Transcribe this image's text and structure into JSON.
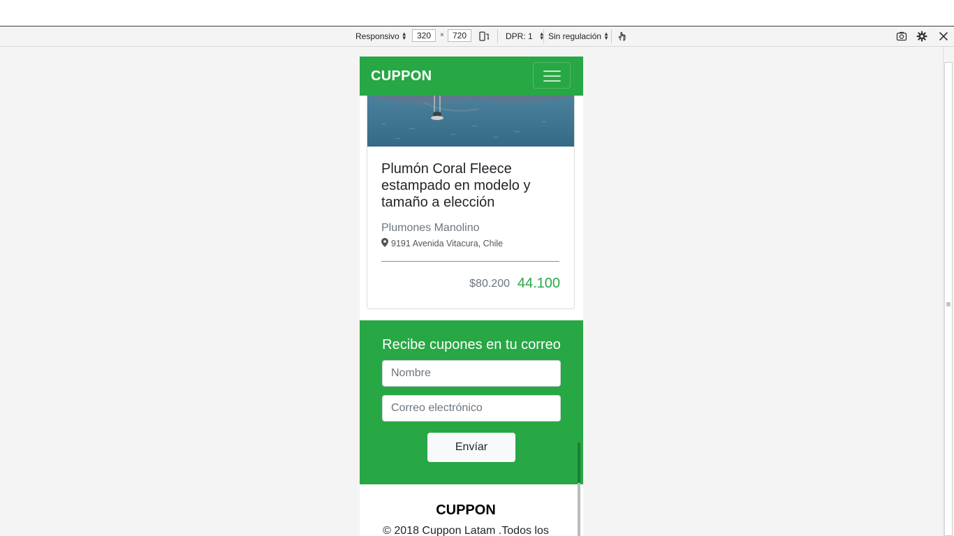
{
  "devtools": {
    "preset": "Responsivo",
    "width": "320",
    "times": "×",
    "height": "720",
    "dpr": "DPR: 1",
    "throttle": "Sin regulación"
  },
  "navbar": {
    "brand": "CUPPON"
  },
  "card": {
    "title": "Plumón Coral Fleece estampado en modelo y tamaño a elección",
    "merchant": "Plumones Manolino",
    "address": "9191 Avenida Vitacura, Chile",
    "price_old": "$80.200",
    "price_new": "44.100"
  },
  "newsletter": {
    "title": "Recibe cupones en tu correo",
    "name_placeholder": "Nombre",
    "email_placeholder": "Correo electrónico",
    "submit": "Envíar"
  },
  "footer": {
    "brand": "CUPPON",
    "copyright": "© 2018 Cuppon Latam .Todos los"
  },
  "colors": {
    "brand": "#28a745",
    "text": "#212529",
    "muted": "#6c757d"
  },
  "icons": [
    "rotate-icon",
    "touch-icon",
    "screenshot-icon",
    "settings-icon",
    "close-icon",
    "map-marker-icon",
    "hamburger-icon"
  ]
}
